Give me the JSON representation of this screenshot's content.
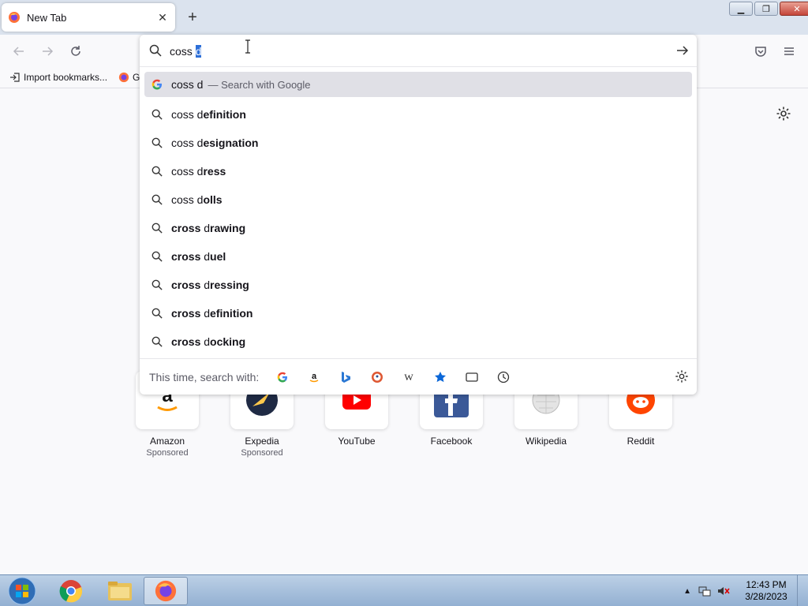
{
  "window": {
    "tab_title": "New Tab",
    "new_tab_symbol": "+",
    "tab_close_symbol": "✕"
  },
  "bookmarks": {
    "import_label": "Import bookmarks...",
    "second_label": "G"
  },
  "urlbar": {
    "typed_prefix": "coss ",
    "typed_selected": "d"
  },
  "results": [
    {
      "icon": "google-icon",
      "prefix": "coss d",
      "bold": "",
      "hint": "— Search with Google"
    },
    {
      "icon": "search-icon",
      "prefix": "coss d",
      "bold": "efinition"
    },
    {
      "icon": "search-icon",
      "prefix": "coss d",
      "bold": "esignation"
    },
    {
      "icon": "search-icon",
      "prefix": "coss d",
      "bold": "ress"
    },
    {
      "icon": "search-icon",
      "prefix": "coss d",
      "bold": "olls"
    },
    {
      "icon": "search-icon",
      "bold_prefix": "cross",
      "prefix": " d",
      "bold": "rawing"
    },
    {
      "icon": "search-icon",
      "bold_prefix": "cross",
      "prefix": " d",
      "bold": "uel"
    },
    {
      "icon": "search-icon",
      "bold_prefix": "cross",
      "prefix": " d",
      "bold": "ressing"
    },
    {
      "icon": "search-icon",
      "bold_prefix": "cross",
      "prefix": " d",
      "bold": "efinition"
    },
    {
      "icon": "search-icon",
      "bold_prefix": "cross",
      "prefix": " d",
      "bold": "ocking"
    }
  ],
  "search_with": {
    "label": "This time, search with:",
    "engines": [
      "google-icon",
      "amazon-icon",
      "bing-icon",
      "duckduckgo-icon",
      "wikipedia-icon",
      "bookmarks-star-icon",
      "tabs-icon",
      "history-icon"
    ]
  },
  "top_sites": [
    {
      "name": "Amazon",
      "sponsored": "Sponsored"
    },
    {
      "name": "Expedia",
      "sponsored": "Sponsored"
    },
    {
      "name": "YouTube",
      "sponsored": ""
    },
    {
      "name": "Facebook",
      "sponsored": ""
    },
    {
      "name": "Wikipedia",
      "sponsored": ""
    },
    {
      "name": "Reddit",
      "sponsored": ""
    }
  ],
  "taskbar": {
    "time": "12:43 PM",
    "date": "3/28/2023"
  },
  "colors": {
    "accent": "#2d6fd8",
    "tab_strip": "#dbe3ee",
    "highlight_row": "#e0e0e6"
  }
}
